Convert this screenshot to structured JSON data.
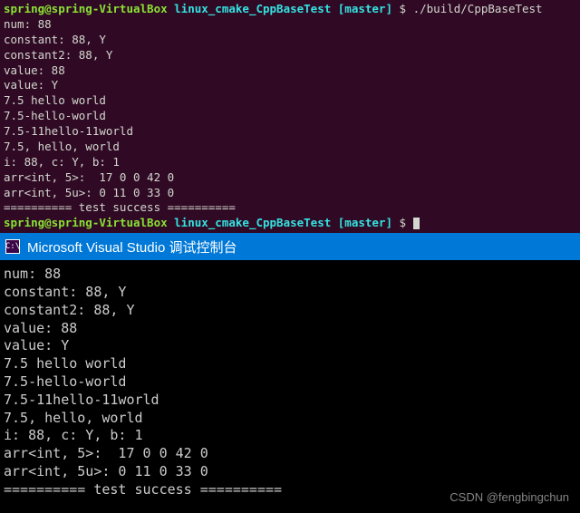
{
  "linux": {
    "prompt": {
      "user_host": "spring@spring-VirtualBox",
      "path": "linux_cmake_CppBaseTest",
      "branch": "[master]",
      "dollar": "$"
    },
    "command": "./build/CppBaseTest",
    "output": [
      "num: 88",
      "constant: 88, Y",
      "constant2: 88, Y",
      "value: 88",
      "value: Y",
      "7.5 hello world",
      "7.5-hello-world",
      "7.5-11hello-11world",
      "7.5, hello, world",
      "i: 88, c: Y, b: 1",
      "arr<int, 5>:  17 0 0 42 0",
      "arr<int, 5u>: 0 11 0 33 0",
      "========== test success =========="
    ]
  },
  "windows": {
    "title": "Microsoft Visual Studio 调试控制台",
    "icon_text": "C:\\",
    "output": [
      "num: 88",
      "constant: 88, Y",
      "constant2: 88, Y",
      "value: 88",
      "value: Y",
      "7.5 hello world",
      "7.5-hello-world",
      "7.5-11hello-11world",
      "7.5, hello, world",
      "i: 88, c: Y, b: 1",
      "arr<int, 5>:  17 0 0 42 0",
      "arr<int, 5u>: 0 11 0 33 0",
      "========== test success =========="
    ]
  },
  "watermark": "CSDN @fengbingchun"
}
